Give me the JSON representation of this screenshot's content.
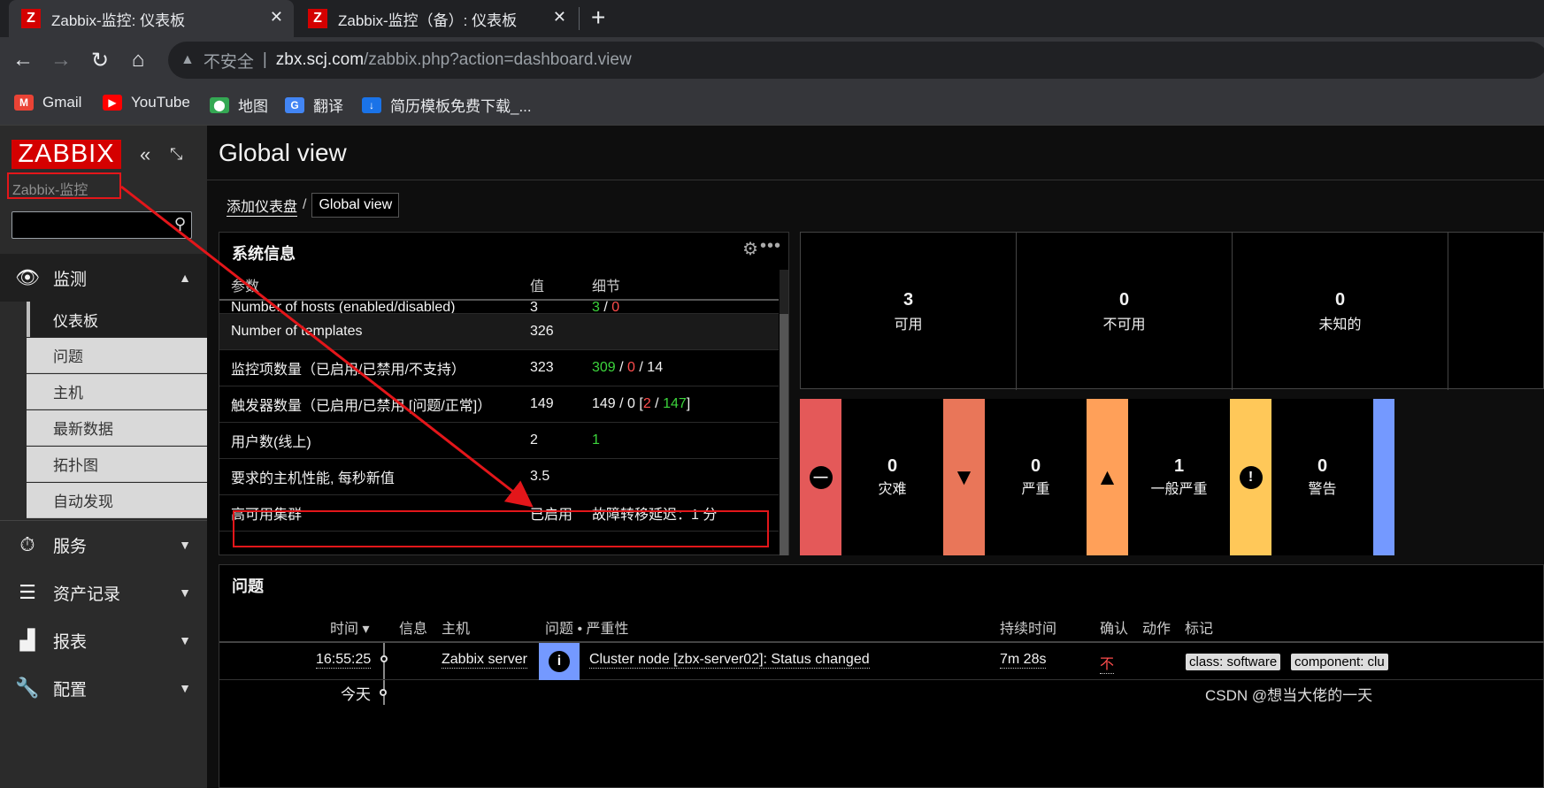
{
  "browser": {
    "tabs": [
      {
        "title": "Zabbix-监控: 仪表板",
        "favicon": "Z"
      },
      {
        "title": "Zabbix-监控（备）: 仪表板",
        "favicon": "Z"
      }
    ],
    "newtab": "+",
    "close": "✕",
    "security_label": "不安全",
    "url_host": "zbx.scj.com",
    "url_path": "/zabbix.php?action=dashboard.view",
    "bookmarks": [
      {
        "label": "Gmail",
        "icon": "gmail-icon",
        "color": "#ea4335"
      },
      {
        "label": "YouTube",
        "icon": "youtube-icon",
        "color": "#ff0000"
      },
      {
        "label": "地图",
        "icon": "maps-icon",
        "color": "#34a853"
      },
      {
        "label": "翻译",
        "icon": "translate-icon",
        "color": "#4285f4"
      },
      {
        "label": "简历模板免费下载_...",
        "icon": "download-icon",
        "color": "#1a73e8"
      }
    ]
  },
  "sidebar": {
    "logo": "ZABBIX",
    "server_name": "Zabbix-监控",
    "menu": [
      {
        "label": "监测",
        "icon": "eye-icon",
        "expanded": true
      },
      {
        "label": "服务",
        "icon": "stopwatch-icon"
      },
      {
        "label": "资产记录",
        "icon": "list-icon"
      },
      {
        "label": "报表",
        "icon": "chart-icon"
      },
      {
        "label": "配置",
        "icon": "wrench-icon"
      }
    ],
    "submenu": [
      "仪表板",
      "问题",
      "主机",
      "最新数据",
      "拓扑图",
      "自动发现"
    ]
  },
  "main": {
    "title": "Global view",
    "breadcrumb": [
      "添加仪表盘",
      "Global view"
    ],
    "breadcrumb_sep": "/"
  },
  "sysinfo": {
    "title": "系统信息",
    "headers": [
      "参数",
      "值",
      "细节"
    ],
    "rows": [
      {
        "param": "Number of hosts (enabled/disabled)",
        "value": "3",
        "detail": [
          {
            "t": "3",
            "c": "green"
          },
          {
            "t": " / "
          },
          {
            "t": "0",
            "c": "red"
          }
        ]
      },
      {
        "param": "Number of templates",
        "value": "326",
        "detail": []
      },
      {
        "param": "监控项数量（已启用/已禁用/不支持）",
        "value": "323",
        "detail": [
          {
            "t": "309",
            "c": "green"
          },
          {
            "t": " / "
          },
          {
            "t": "0",
            "c": "red"
          },
          {
            "t": " / 14"
          }
        ]
      },
      {
        "param": "触发器数量（已启用/已禁用 [问题/正常]）",
        "value": "149",
        "detail": [
          {
            "t": "149 / 0 ["
          },
          {
            "t": "2",
            "c": "red"
          },
          {
            "t": " / "
          },
          {
            "t": "147",
            "c": "green"
          },
          {
            "t": "]"
          }
        ]
      },
      {
        "param": "用户数(线上)",
        "value": "2",
        "detail": [
          {
            "t": "1",
            "c": "green"
          }
        ]
      },
      {
        "param": "要求的主机性能, 每秒新值",
        "value": "3.5",
        "detail": []
      },
      {
        "param": "高可用集群",
        "value": "已启用",
        "value_color": "green",
        "detail": [
          {
            "t": "故障转移延迟：1 分"
          }
        ]
      }
    ]
  },
  "host_availability": [
    {
      "count": "3",
      "label": "可用"
    },
    {
      "count": "0",
      "label": "不可用"
    },
    {
      "count": "0",
      "label": "未知的"
    }
  ],
  "severities": [
    {
      "count": "0",
      "label": "灾难",
      "color": "#e45959",
      "icon": "disaster-icon"
    },
    {
      "count": "0",
      "label": "严重",
      "color": "#e97659",
      "icon": "high-icon"
    },
    {
      "count": "1",
      "label": "一般严重",
      "color": "#ffa059",
      "icon": "average-icon"
    },
    {
      "count": "0",
      "label": "警告",
      "color": "#ffc859",
      "icon": "warning-icon"
    },
    {
      "color": "#7499ff"
    }
  ],
  "problems": {
    "title": "问题",
    "headers": [
      "时间 ▾",
      "信息",
      "主机",
      "问题 • 严重性",
      "持续时间",
      "确认",
      "动作",
      "标记"
    ],
    "row": {
      "time": "16:55:25",
      "host": "Zabbix server",
      "problem": "Cluster node [zbx-server02]: Status changed",
      "duration": "7m 28s",
      "ack": "不",
      "tags": [
        "class: software",
        "component: clu"
      ]
    },
    "today": "今天"
  },
  "watermark": "CSDN @想当大佬的一天"
}
